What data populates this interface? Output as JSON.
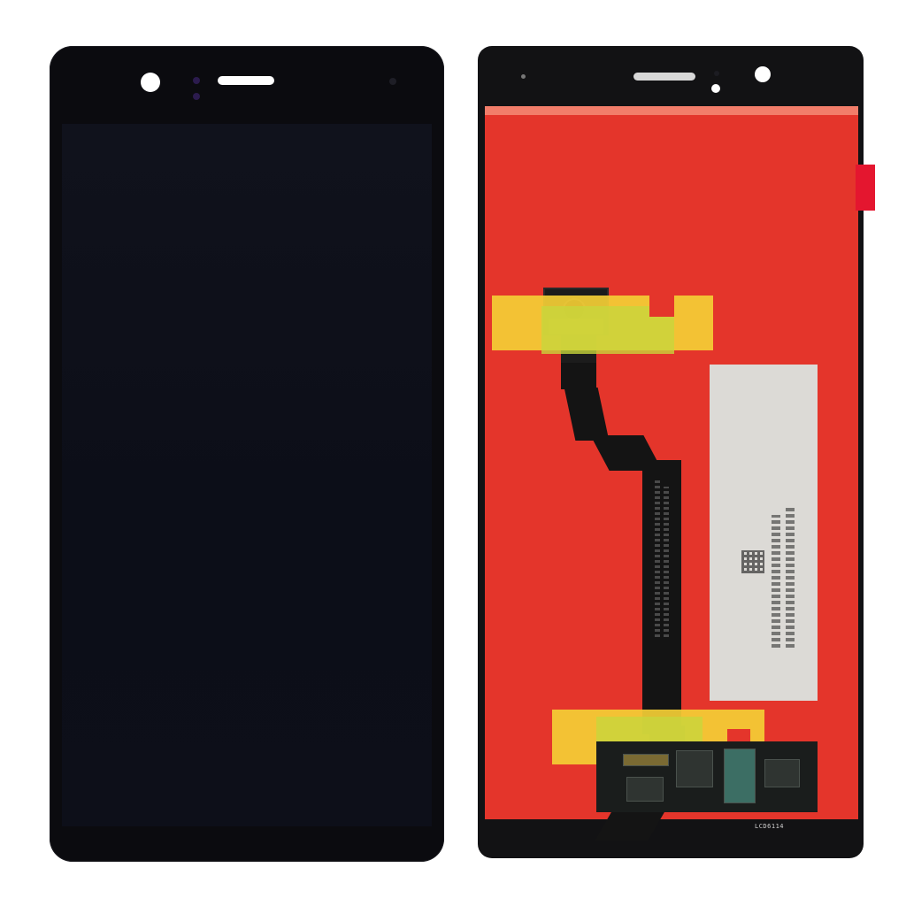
{
  "back_panel": {
    "board_label": "LCD6114"
  }
}
